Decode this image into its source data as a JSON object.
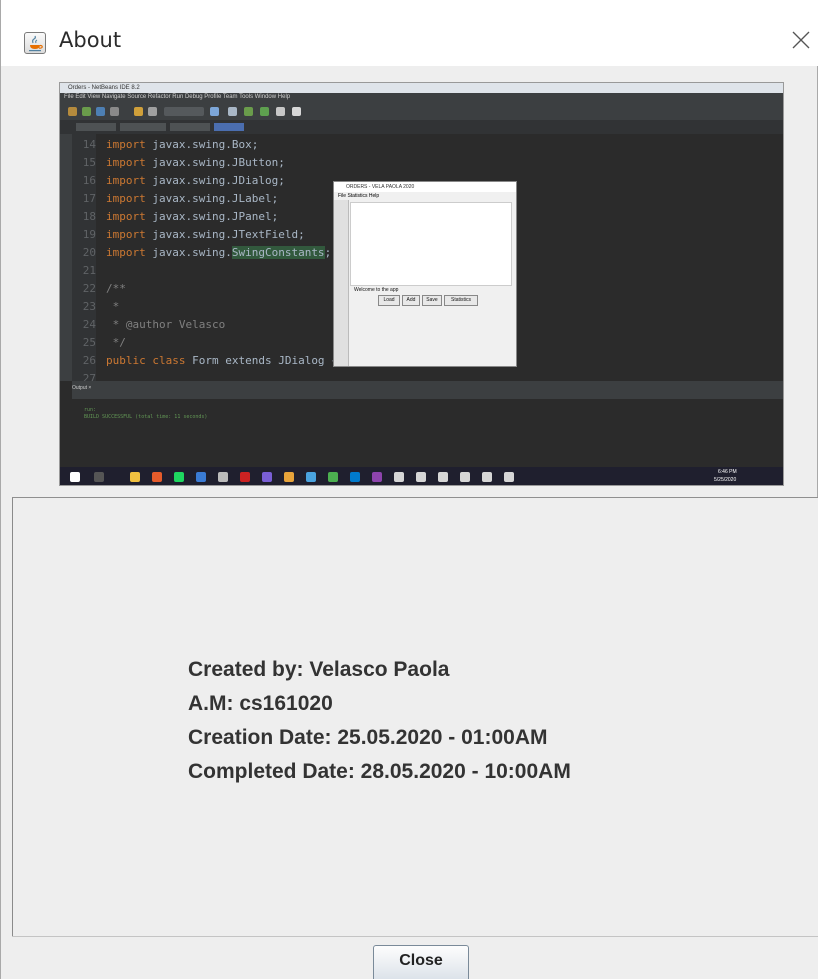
{
  "window": {
    "title": "About",
    "icon": "java-coffee-icon",
    "close_icon": "close-icon"
  },
  "screenshot": {
    "description_icon": "netbeans-screenshot",
    "app_title": "Orders - NetBeans IDE 8.2",
    "menu": "File  Edit  View  Navigate  Source  Refactor  Run  Debug  Profile  Team  Tools  Window  Help",
    "code_lines": [
      {
        "num": "14",
        "kw": "import",
        "rest": " javax.swing.Box;"
      },
      {
        "num": "15",
        "kw": "import",
        "rest": " javax.swing.JButton;"
      },
      {
        "num": "16",
        "kw": "import",
        "rest": " javax.swing.JDialog;"
      },
      {
        "num": "17",
        "kw": "import",
        "rest": " javax.swing.JLabel;"
      },
      {
        "num": "18",
        "kw": "import",
        "rest": " javax.swing.JPanel;"
      },
      {
        "num": "19",
        "kw": "import",
        "rest": " javax.swing.JTextField;"
      },
      {
        "num": "20",
        "kw": "import",
        "rest": " javax.swing.",
        "hl": "SwingConstants",
        "tail": ";"
      },
      {
        "num": "21",
        "kw": "",
        "rest": ""
      },
      {
        "num": "22",
        "kw": "",
        "rest": "/**"
      },
      {
        "num": "23",
        "kw": "",
        "rest": " *"
      },
      {
        "num": "24",
        "kw": "",
        "rest": " * @author Velasco"
      },
      {
        "num": "25",
        "kw": "",
        "rest": " */"
      },
      {
        "num": "26",
        "kw": "public class",
        "rest": " Form extends JDialog {"
      },
      {
        "num": "27",
        "kw": "",
        "rest": ""
      }
    ],
    "dialog": {
      "title": "ORDERS - VELA PAOLA 2020",
      "menu": "File   Statistics   Help",
      "welcome": "Welcome to the app",
      "buttons": [
        "Load",
        "Add",
        "Save",
        "Statistics"
      ]
    },
    "output": {
      "tabs": "Output  ×",
      "line1": "run:",
      "line2": "BUILD SUCCESSFUL (total time: 11 seconds)"
    },
    "clock": {
      "time": "6:46 PM",
      "date": "5/25/2020"
    }
  },
  "info": {
    "created_by": "Created by: Velasco Paola",
    "am": "A.M: cs161020",
    "creation_date": "Creation Date: 25.05.2020 - 01:00AM",
    "completed_date": "Completed Date: 28.05.2020 - 10:00AM"
  },
  "buttons": {
    "close_label": "Close"
  }
}
